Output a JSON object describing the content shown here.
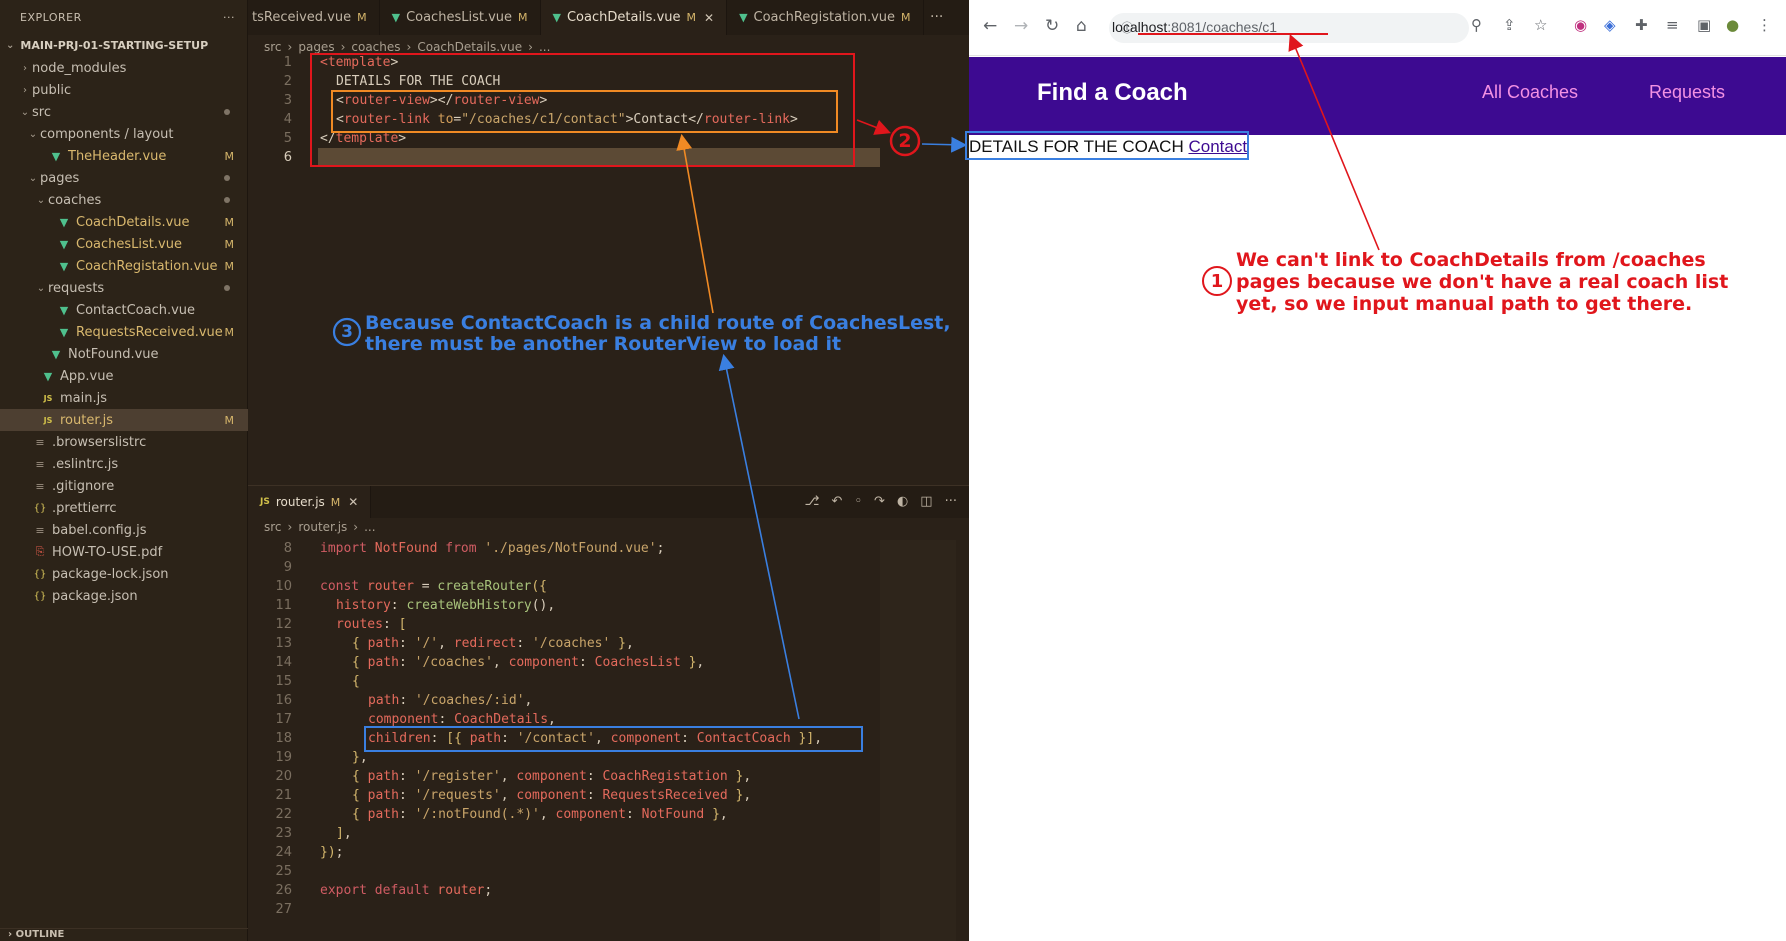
{
  "explorer": {
    "title": "EXPLORER",
    "more": "···",
    "project": "MAIN-PRJ-01-STARTING-SETUP",
    "items": [
      {
        "label": "node_modules",
        "kind": "folder",
        "collapsed": true,
        "indent": 0
      },
      {
        "label": "public",
        "kind": "folder",
        "collapsed": true,
        "indent": 0
      },
      {
        "label": "src",
        "kind": "folder",
        "collapsed": false,
        "indent": 0,
        "dot": true
      },
      {
        "label": "components / layout",
        "kind": "folder",
        "collapsed": false,
        "indent": 1
      },
      {
        "label": "TheHeader.vue",
        "kind": "vue",
        "indent": 2,
        "status": "M"
      },
      {
        "label": "pages",
        "kind": "folder",
        "collapsed": false,
        "indent": 1,
        "dot": true
      },
      {
        "label": "coaches",
        "kind": "folder",
        "collapsed": false,
        "indent": 2,
        "dot": true
      },
      {
        "label": "CoachDetails.vue",
        "kind": "vue",
        "indent": 3,
        "status": "M"
      },
      {
        "label": "CoachesList.vue",
        "kind": "vue",
        "indent": 3,
        "status": "M"
      },
      {
        "label": "CoachRegistation.vue",
        "kind": "vue",
        "indent": 3,
        "status": "M"
      },
      {
        "label": "requests",
        "kind": "folder",
        "collapsed": false,
        "indent": 2,
        "dot": true
      },
      {
        "label": "ContactCoach.vue",
        "kind": "vue",
        "indent": 3
      },
      {
        "label": "RequestsReceived.vue",
        "kind": "vue",
        "indent": 3,
        "status": "M"
      },
      {
        "label": "NotFound.vue",
        "kind": "vue",
        "indent": 2
      },
      {
        "label": "App.vue",
        "kind": "vue",
        "indent": 1
      },
      {
        "label": "main.js",
        "kind": "js",
        "indent": 1
      },
      {
        "label": "router.js",
        "kind": "js",
        "indent": 1,
        "status": "M",
        "selected": true
      },
      {
        "label": ".browserslistrc",
        "kind": "gen",
        "indent": 0
      },
      {
        "label": ".eslintrc.js",
        "kind": "gen",
        "indent": 0
      },
      {
        "label": ".gitignore",
        "kind": "gen",
        "indent": 0
      },
      {
        "label": ".prettierrc",
        "kind": "json",
        "indent": 0
      },
      {
        "label": "babel.config.js",
        "kind": "gen",
        "indent": 0
      },
      {
        "label": "HOW-TO-USE.pdf",
        "kind": "pdf",
        "indent": 0
      },
      {
        "label": "package-lock.json",
        "kind": "json",
        "indent": 0
      },
      {
        "label": "package.json",
        "kind": "json",
        "indent": 0
      }
    ],
    "outline": "OUTLINE"
  },
  "editor_top": {
    "tabs": [
      {
        "label": "tsReceived.vue",
        "modified": "M"
      },
      {
        "label": "CoachesList.vue",
        "modified": "M"
      },
      {
        "label": "CoachDetails.vue",
        "modified": "M",
        "active": true
      },
      {
        "label": "CoachRegistation.vue",
        "modified": "M"
      }
    ],
    "breadcrumb": [
      "src",
      "pages",
      "coaches",
      "CoachDetails.vue",
      "..."
    ],
    "line_numbers": [
      "1",
      "2",
      "3",
      "4",
      "5",
      "6"
    ]
  },
  "editor_bottom": {
    "tab": {
      "label": "router.js",
      "modified": "M"
    },
    "breadcrumb": [
      "src",
      "router.js",
      "..."
    ],
    "line_numbers": [
      "8",
      "9",
      "10",
      "11",
      "12",
      "13",
      "14",
      "15",
      "16",
      "17",
      "18",
      "19",
      "20",
      "21",
      "22",
      "23",
      "24",
      "25",
      "26",
      "27"
    ]
  },
  "browser": {
    "url_host": "localhost",
    "url_path": ":8081/coaches/c1",
    "brand": "Find a Coach",
    "nav": [
      "All Coaches",
      "Requests"
    ],
    "page_text": "DETAILS FOR THE COACH",
    "page_link": "Contact"
  },
  "annotations": {
    "note1_number": "1",
    "note1_lines": [
      "We can't link to CoachDetails from /coaches",
      "pages because we don't have a real coach list",
      "yet, so we input manual path  to get there."
    ],
    "note2_number": "2",
    "note3_number": "3",
    "note3_lines": [
      "Because ContactCoach is a child route of CoachesLest,",
      "there must be another RouterView to load it"
    ]
  },
  "colors": {
    "annotation_red": "#e0161c",
    "annotation_blue": "#3a7fe0",
    "annotation_orange": "#f08a24",
    "header_purple": "#3d0a91",
    "nav_pink": "#f391e3"
  }
}
